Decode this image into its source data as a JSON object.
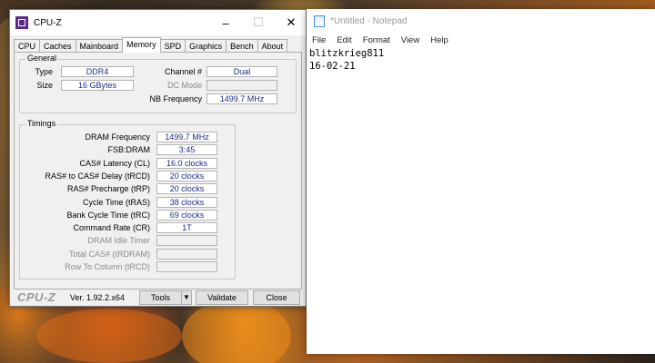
{
  "cpuz": {
    "window_title": "CPU-Z",
    "tabs": [
      "CPU",
      "Caches",
      "Mainboard",
      "Memory",
      "SPD",
      "Graphics",
      "Bench",
      "About"
    ],
    "active_tab": "Memory",
    "general": {
      "title": "General",
      "type_label": "Type",
      "type_value": "DDR4",
      "size_label": "Size",
      "size_value": "16 GBytes",
      "channel_label": "Channel #",
      "channel_value": "Dual",
      "dc_mode_label": "DC Mode",
      "dc_mode_value": "",
      "nb_freq_label": "NB Frequency",
      "nb_freq_value": "1499.7 MHz"
    },
    "timings": {
      "title": "Timings",
      "rows": [
        {
          "label": "DRAM Frequency",
          "value": "1499.7 MHz",
          "enabled": true
        },
        {
          "label": "FSB:DRAM",
          "value": "3:45",
          "enabled": true
        },
        {
          "label": "CAS# Latency (CL)",
          "value": "16.0 clocks",
          "enabled": true
        },
        {
          "label": "RAS# to CAS# Delay (tRCD)",
          "value": "20 clocks",
          "enabled": true
        },
        {
          "label": "RAS# Precharge (tRP)",
          "value": "20 clocks",
          "enabled": true
        },
        {
          "label": "Cycle Time (tRAS)",
          "value": "38 clocks",
          "enabled": true
        },
        {
          "label": "Bank Cycle Time (tRC)",
          "value": "69 clocks",
          "enabled": true
        },
        {
          "label": "Command Rate (CR)",
          "value": "1T",
          "enabled": true
        },
        {
          "label": "DRAM Idle Timer",
          "value": "",
          "enabled": false
        },
        {
          "label": "Total CAS# (tRDRAM)",
          "value": "",
          "enabled": false
        },
        {
          "label": "Row To Column (tRCD)",
          "value": "",
          "enabled": false
        }
      ]
    },
    "footer": {
      "brand": "CPU-Z",
      "version": "Ver. 1.92.2.x64",
      "tools_label": "Tools",
      "validate_label": "Validate",
      "close_label": "Close"
    }
  },
  "notepad": {
    "window_title": "*Untitled - Notepad",
    "menu": [
      "File",
      "Edit",
      "Format",
      "View",
      "Help"
    ],
    "lines": [
      "blitzkrieg811",
      "16-02-21"
    ]
  },
  "icons": {
    "cpuz_logo": "cpuz-logo-icon",
    "minimize": "minimize-icon",
    "maximize": "maximize-icon",
    "close": "close-icon",
    "dropdown": "triangle-down-icon",
    "notepad": "notepad-icon"
  },
  "colors": {
    "value_text": "#1a2a8a",
    "cpuz_logo": "#5b2a86"
  }
}
